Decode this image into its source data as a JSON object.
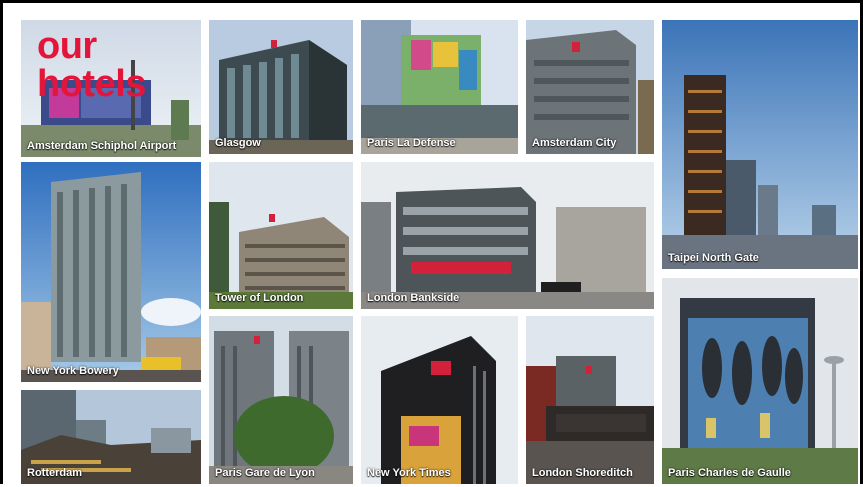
{
  "title": "our hotels",
  "hotels": [
    {
      "name": "Amsterdam Schiphol Airport"
    },
    {
      "name": "Glasgow"
    },
    {
      "name": "Paris La Defense"
    },
    {
      "name": "Amsterdam City"
    },
    {
      "name": "Taipei North Gate"
    },
    {
      "name": "New York Bowery"
    },
    {
      "name": "Tower of London"
    },
    {
      "name": "London Bankside"
    },
    {
      "name": "Paris Charles de Gaulle"
    },
    {
      "name": "Rotterdam"
    },
    {
      "name": "Paris Gare de Lyon"
    },
    {
      "name": "New York Times"
    },
    {
      "name": "London Shoreditch"
    }
  ],
  "colors": {
    "accent": "#e3153b"
  }
}
